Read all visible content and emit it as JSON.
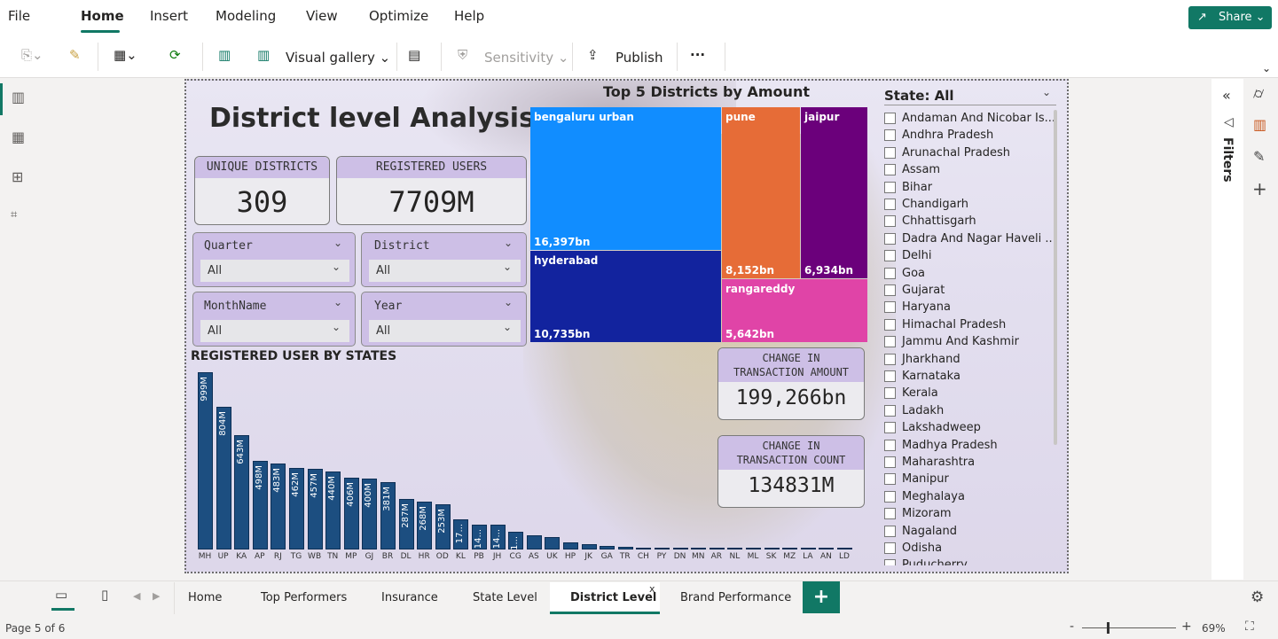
{
  "menu": [
    "File",
    "Home",
    "Insert",
    "Modeling",
    "View",
    "Optimize",
    "Help"
  ],
  "share_label": "Share",
  "toolbar": {
    "visual_gallery": "Visual gallery",
    "sensitivity": "Sensitivity",
    "publish": "Publish",
    "more": "···"
  },
  "report": {
    "title": "District level Analysis",
    "cards": {
      "unique_districts": {
        "label": "UNIQUE DISTRICTS",
        "value": "309"
      },
      "registered_users": {
        "label": "REGISTERED USERS",
        "value": "7709M"
      },
      "change_amount": {
        "label1": "CHANGE IN",
        "label2": "TRANSACTION AMOUNT",
        "value": "199,266bn"
      },
      "change_count": {
        "label1": "CHANGE IN",
        "label2": "TRANSACTION COUNT",
        "value": "134831M"
      }
    },
    "slicers": {
      "quarter": {
        "label": "Quarter",
        "value": "All"
      },
      "district": {
        "label": "District",
        "value": "All"
      },
      "monthname": {
        "label": "MonthName",
        "value": "All"
      },
      "year": {
        "label": "Year",
        "value": "All"
      }
    },
    "treemap": {
      "title": "Top 5 Districts by Amount",
      "items": [
        {
          "name": "bengaluru urban",
          "value": "16,397bn",
          "color": "#118dff"
        },
        {
          "name": "hyderabad",
          "value": "10,735bn",
          "color": "#12239e"
        },
        {
          "name": "pune",
          "value": "8,152bn",
          "color": "#e66c37"
        },
        {
          "name": "jaipur",
          "value": "6,934bn",
          "color": "#6b007b"
        },
        {
          "name": "rangareddy",
          "value": "5,642bn",
          "color": "#e044a7"
        }
      ]
    },
    "state_filter": {
      "label": "State: All",
      "states": [
        "Andaman And Nicobar Is...",
        "Andhra Pradesh",
        "Arunachal Pradesh",
        "Assam",
        "Bihar",
        "Chandigarh",
        "Chhattisgarh",
        "Dadra And Nagar Haveli ...",
        "Delhi",
        "Goa",
        "Gujarat",
        "Haryana",
        "Himachal Pradesh",
        "Jammu And Kashmir",
        "Jharkhand",
        "Karnataka",
        "Kerala",
        "Ladakh",
        "Lakshadweep",
        "Madhya Pradesh",
        "Maharashtra",
        "Manipur",
        "Meghalaya",
        "Mizoram",
        "Nagaland",
        "Odisha",
        "Puducherry"
      ]
    }
  },
  "chart_data": {
    "type": "bar",
    "title": "REGISTERED USER BY STATES",
    "categories": [
      "MH",
      "UP",
      "KA",
      "AP",
      "RJ",
      "TG",
      "WB",
      "TN",
      "MP",
      "GJ",
      "BR",
      "DL",
      "HR",
      "OD",
      "KL",
      "PB",
      "JH",
      "CG",
      "AS",
      "UK",
      "HP",
      "JK",
      "GA",
      "TR",
      "CH",
      "PY",
      "DN",
      "MN",
      "AR",
      "NL",
      "ML",
      "SK",
      "MZ",
      "LA",
      "AN",
      "LD"
    ],
    "values": [
      999,
      804,
      643,
      498,
      483,
      462,
      457,
      440,
      406,
      400,
      381,
      287,
      268,
      253,
      170,
      140,
      140,
      100,
      80,
      70,
      40,
      30,
      20,
      15,
      12,
      10,
      8,
      7,
      6,
      5,
      5,
      4,
      3,
      2,
      1,
      1
    ],
    "data_labels": [
      "999M",
      "804M",
      "643M",
      "498M",
      "483M",
      "462M",
      "457M",
      "440M",
      "406M",
      "400M",
      "381M",
      "287M",
      "268M",
      "253M",
      "17...",
      "14...",
      "14...",
      "1...",
      "",
      "",
      "",
      "",
      "",
      "",
      "",
      "",
      "",
      "",
      "",
      "",
      "",
      "",
      "",
      "",
      "",
      ""
    ],
    "ylabel": "",
    "xlabel": "",
    "ylim": [
      0,
      1050
    ]
  },
  "filters_label": "Filters",
  "pages": {
    "tabs": [
      "Home",
      "Top Performers",
      "Insurance",
      "State Level",
      "District Level",
      "Brand Performance"
    ],
    "active": "District Level",
    "add": "+",
    "status": "Page 5 of 6"
  },
  "zoom": "69%"
}
